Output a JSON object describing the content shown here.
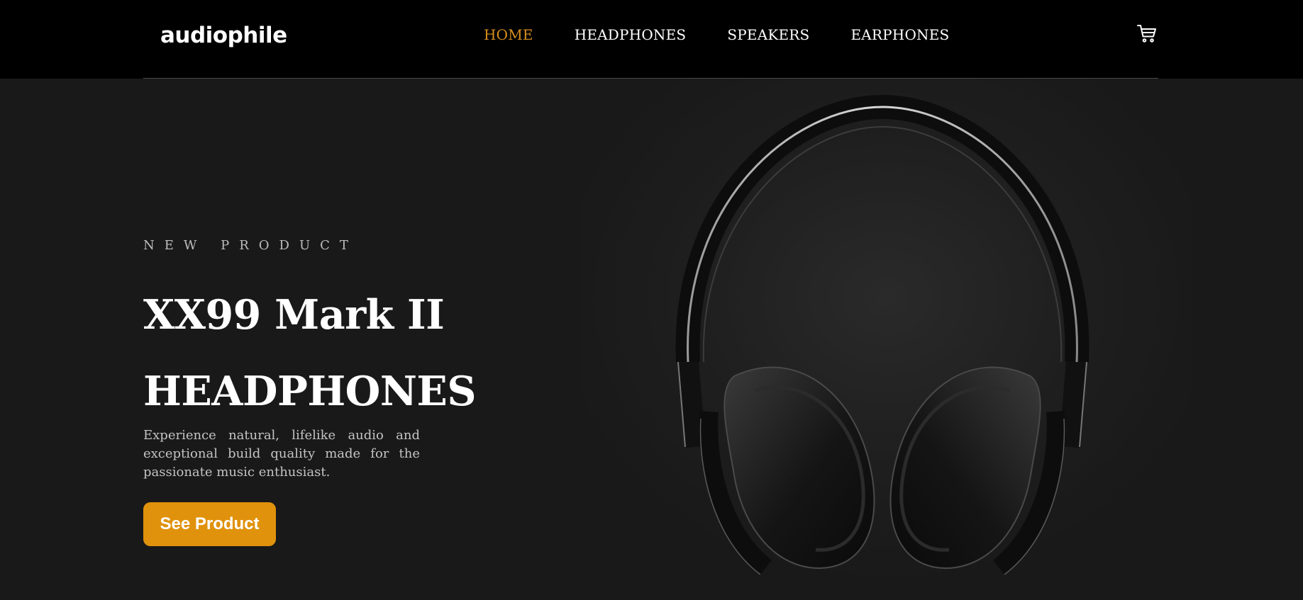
{
  "header": {
    "logo": "audiophile",
    "nav": [
      {
        "label": "HOME",
        "active": true
      },
      {
        "label": "HEADPHONES",
        "active": false
      },
      {
        "label": "SPEAKERS",
        "active": false
      },
      {
        "label": "EARPHONES",
        "active": false
      }
    ],
    "cart_icon": "cart-icon"
  },
  "hero": {
    "eyebrow": "NEW PRODUCT",
    "title_line1": "XX99 Mark II",
    "title_line2": "HEADPHONES",
    "description": "Experience natural, lifelike audio and exceptional build quality made for the passionate music enthusiast.",
    "cta_label": "See Product",
    "image_icon": "headphones-image"
  },
  "colors": {
    "accent": "#d88f1d",
    "button": "#e0920c",
    "hero_bg": "#191919",
    "header_bg": "#000000"
  }
}
